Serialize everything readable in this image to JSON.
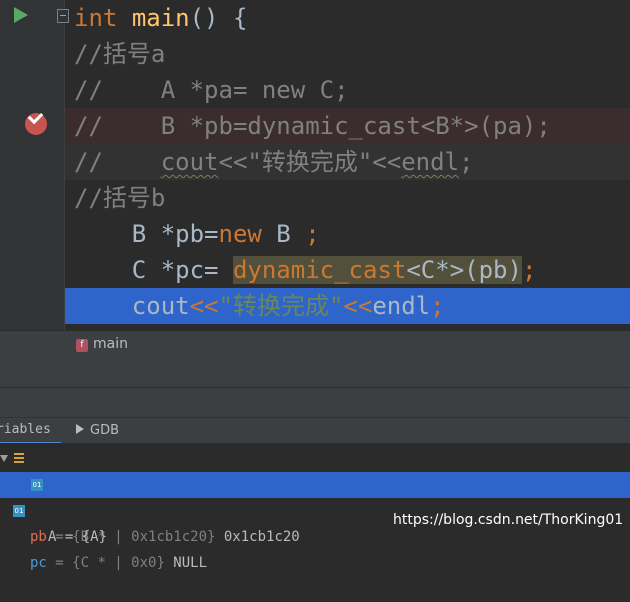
{
  "editor": {
    "lines": [
      {
        "kw": "int",
        "fn": "main",
        "rest": "() {"
      },
      {
        "comment": "//括号a"
      },
      {
        "comment": "//    A *pa= new C;"
      },
      {
        "comment": "//    B *pb=dynamic_cast<B*>(pa);"
      },
      {
        "comment_pre": "//    ",
        "comment_ul1": "cout",
        "comment_mid": "<<\"转换完成\"<<",
        "comment_ul2": "endl",
        "comment_post": ";"
      },
      {
        "comment": "//括号b"
      },
      {
        "pre": "    B *pb=",
        "kw": "new",
        "post": " B ",
        "semi": ";"
      },
      {
        "pre": "    C *pc= ",
        "dyn": "dynamic_cast",
        "post": "<C*>(pb)",
        "semi": ";"
      },
      {
        "pre": "    cout",
        "op": "<<",
        "str": "\"转换完成\"",
        "op2": "<<",
        "post": "endl",
        "semi": ";"
      }
    ]
  },
  "breadcrumb": {
    "badge": "f",
    "label": "main"
  },
  "debug_tabs": {
    "variables": "riables",
    "gdb": "GDB"
  },
  "variables": [
    {
      "name": "pb",
      "eq": " = ",
      "type": "{B * | 0x1cb1c20}",
      "value": " 0x1cb1c20"
    },
    {
      "name": "A",
      "eq": " = ",
      "value": "{A}"
    },
    {
      "name": "pc",
      "eq": " = ",
      "type": "{C * | 0x0}",
      "value": " NULL"
    }
  ],
  "icons": {
    "field_badge": "01"
  },
  "watermark": "https://blog.csdn.net/ThorKing01",
  "colors": {
    "keyword": "#cc7832",
    "function": "#ffc66d",
    "comment": "#808080",
    "string": "#6a8759",
    "selection": "#2f65ca",
    "breakpoint_line": "#3b2d2d"
  }
}
